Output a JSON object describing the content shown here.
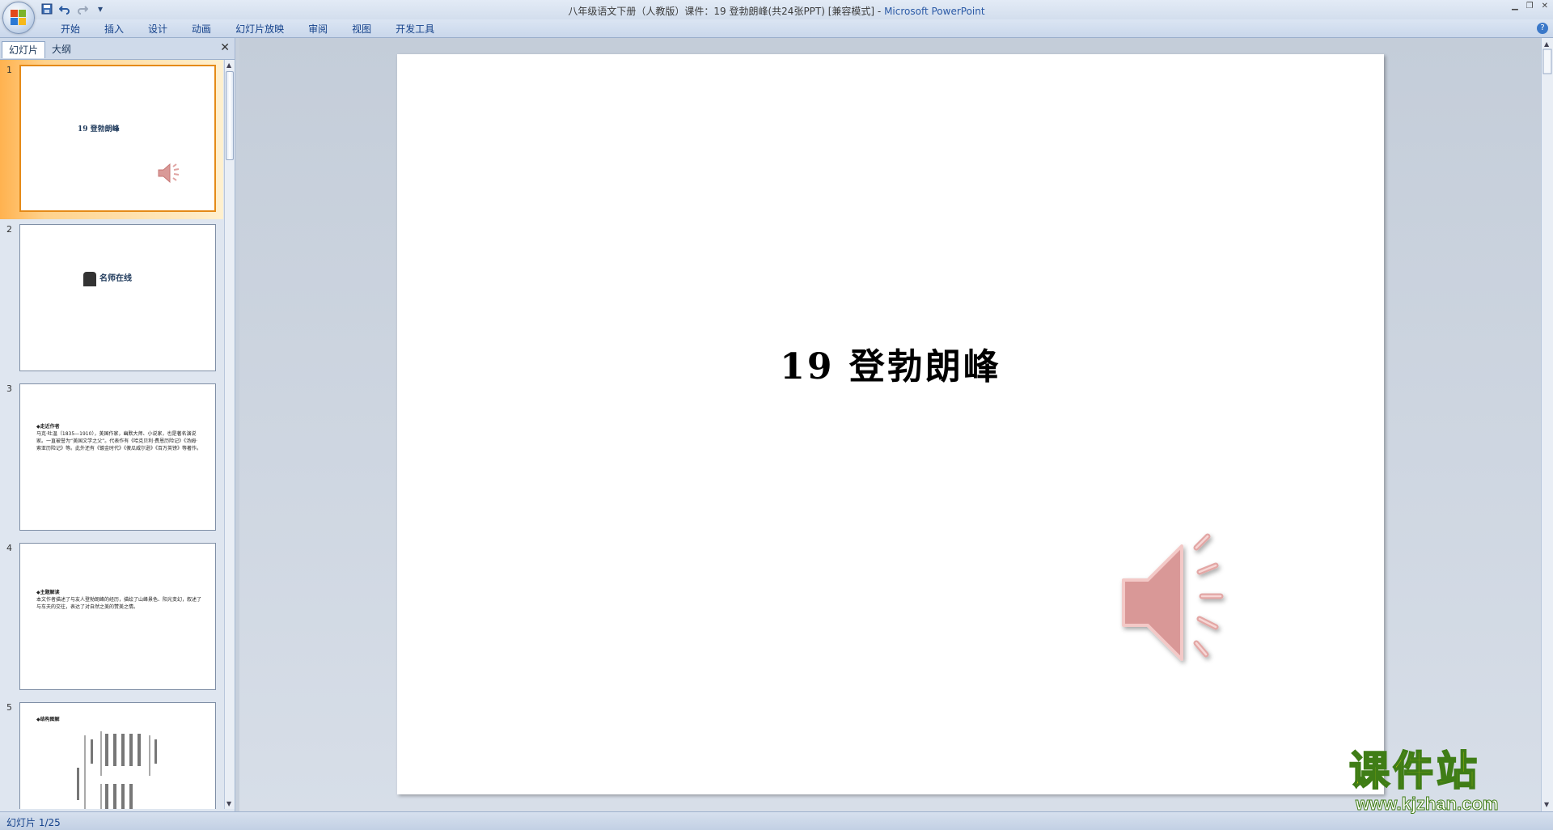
{
  "window": {
    "title": "八年级语文下册（人教版）课件：19    登勃朗峰(共24张PPT) [兼容模式] - ",
    "app_name": "Microsoft PowerPoint"
  },
  "quick_access": [
    "save-icon",
    "undo-icon",
    "redo-icon",
    "customize-icon"
  ],
  "ribbon": {
    "tabs": [
      "开始",
      "插入",
      "设计",
      "动画",
      "幻灯片放映",
      "审阅",
      "视图",
      "开发工具"
    ]
  },
  "panel": {
    "tabs": [
      "幻灯片",
      "大纲"
    ],
    "slides": [
      {
        "num": "1",
        "text": "19    登勃朗峰"
      },
      {
        "num": "2",
        "text": "名师在线"
      },
      {
        "num": "3",
        "heading": "◆走近作者",
        "text": "马克·吐温（1835—1910），美国作家，幽默大师、小说家，也是著名演说家。一直被誉为“美国文学之父”。代表作有《哈克贝利·费恩历险记》《汤姆·索亚历险记》等。此外还有《镀金时代》《傻瓜威尔逊》《百万英镑》等著作。"
      },
      {
        "num": "4",
        "heading": "◆主题解读",
        "text": "本文作者描述了与友人登勃朗峰的经历，描绘了山峰景色、阳光变幻，叙述了与车夫的交往，表达了对自然之美的赞美之情。"
      },
      {
        "num": "5",
        "heading": "◆结构图解"
      }
    ]
  },
  "slide": {
    "title": "19    登勃朗峰"
  },
  "status": {
    "text": "幻灯片 1/25"
  },
  "watermark": {
    "main": "课件站",
    "url": "www.kjzhan.com"
  }
}
